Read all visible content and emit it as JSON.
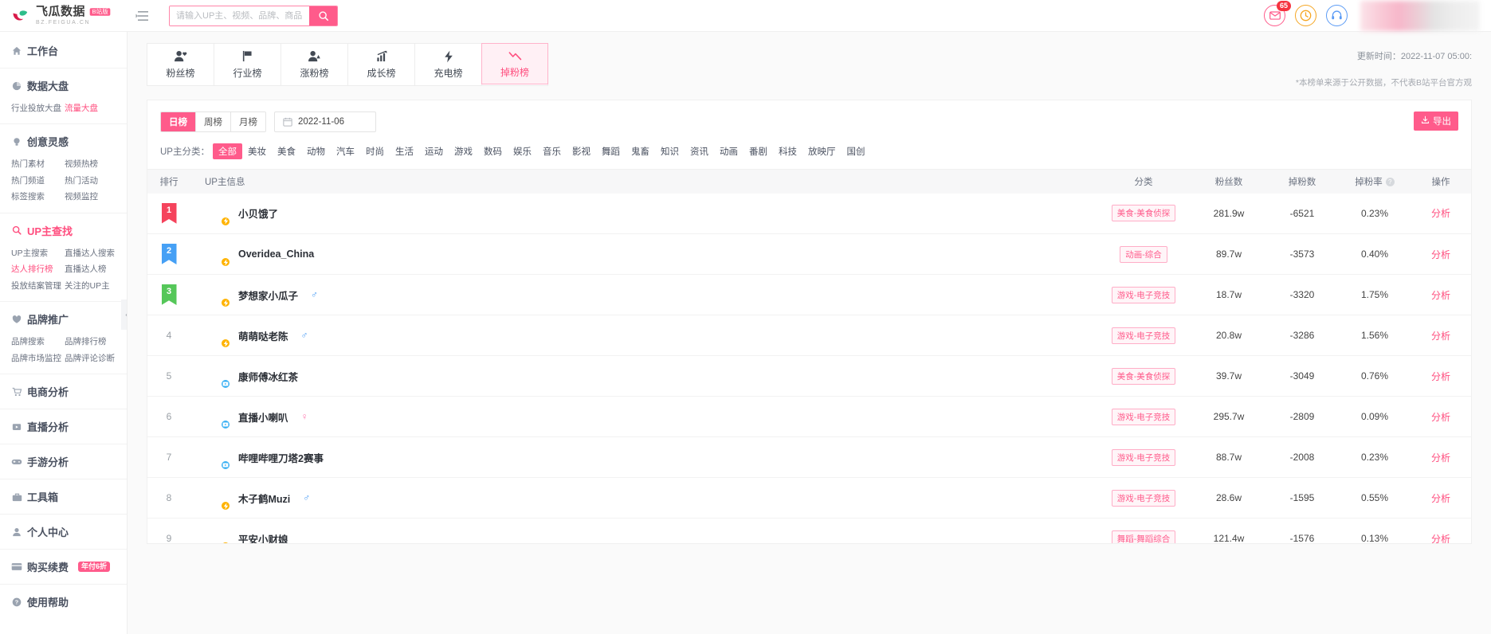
{
  "brand": {
    "name": "飞瓜数据",
    "badge": "B站版",
    "sub": "BZ.FEIGUA.CN"
  },
  "search": {
    "placeholder": "请输入UP主、视频、品牌、商品关键词搜索",
    "value": "",
    "icon": "search-icon"
  },
  "topbar": {
    "collapse_icon": "menu-collapse-icon",
    "mail_icon": "mail-icon",
    "mail_badge": "65",
    "clock_icon": "clock-icon",
    "service_icon": "headset-icon"
  },
  "sidebar": {
    "groups": [
      {
        "icon": "home-icon",
        "title": "工作台",
        "accent": false,
        "links": []
      },
      {
        "icon": "pie-chart-icon",
        "title": "数据大盘",
        "accent": false,
        "links": [
          {
            "label": "行业投放大盘",
            "active": false
          },
          {
            "label": "流量大盘",
            "active": true
          }
        ]
      },
      {
        "icon": "bulb-icon",
        "title": "创意灵感",
        "accent": false,
        "links": [
          {
            "label": "热门素材",
            "active": false
          },
          {
            "label": "视频热榜",
            "active": false
          },
          {
            "label": "热门频道",
            "active": false
          },
          {
            "label": "热门活动",
            "active": false
          },
          {
            "label": "标签搜索",
            "active": false
          },
          {
            "label": "视频监控",
            "active": false
          }
        ]
      },
      {
        "icon": "search-icon",
        "title": "UP主查找",
        "accent": true,
        "links": [
          {
            "label": "UP主搜索",
            "active": false
          },
          {
            "label": "直播达人搜索",
            "active": false
          },
          {
            "label": "达人排行榜",
            "active": true
          },
          {
            "label": "直播达人榜",
            "active": false
          },
          {
            "label": "投放结案管理",
            "active": false
          },
          {
            "label": "关注的UP主",
            "active": false
          }
        ]
      },
      {
        "icon": "heart-shield-icon",
        "title": "品牌推广",
        "accent": false,
        "links": [
          {
            "label": "品牌搜索",
            "active": false
          },
          {
            "label": "品牌排行榜",
            "active": false
          },
          {
            "label": "品牌市场监控",
            "active": false
          },
          {
            "label": "品牌评论诊断",
            "active": false
          }
        ]
      },
      {
        "icon": "cart-icon",
        "title": "电商分析",
        "accent": false,
        "links": []
      },
      {
        "icon": "live-icon",
        "title": "直播分析",
        "accent": false,
        "links": []
      },
      {
        "icon": "gamepad-icon",
        "title": "手游分析",
        "accent": false,
        "links": []
      },
      {
        "icon": "toolbox-icon",
        "title": "工具箱",
        "accent": false,
        "links": []
      },
      {
        "icon": "user-icon",
        "title": "个人中心",
        "accent": false,
        "links": []
      },
      {
        "icon": "card-icon",
        "title": "购买续费",
        "tag": "年付6折",
        "accent": false,
        "links": []
      },
      {
        "icon": "question-icon",
        "title": "使用帮助",
        "accent": false,
        "links": []
      }
    ],
    "collapse_handle": "«"
  },
  "tabs": [
    {
      "label": "粉丝榜",
      "icon": "fans-icon",
      "active": false
    },
    {
      "label": "行业榜",
      "icon": "flag-icon",
      "active": false
    },
    {
      "label": "涨粉榜",
      "icon": "fans-up-icon",
      "active": false
    },
    {
      "label": "成长榜",
      "icon": "growth-chart-icon",
      "active": false
    },
    {
      "label": "充电榜",
      "icon": "bolt-icon",
      "active": false
    },
    {
      "label": "掉粉榜",
      "icon": "chart-down-icon",
      "active": true
    }
  ],
  "header_meta": {
    "update_time": "更新时间：2022-11-07 05:00:",
    "note": "*本榜单来源于公开数据，不代表B站平台官方观"
  },
  "filters": {
    "period": [
      {
        "label": "日榜",
        "active": true
      },
      {
        "label": "周榜",
        "active": false
      },
      {
        "label": "月榜",
        "active": false
      }
    ],
    "date_icon": "calendar-icon",
    "date_value": "2022-11-06",
    "export_label": "导出",
    "export_icon": "export-icon",
    "category_label": "UP主分类：",
    "categories": [
      {
        "label": "全部",
        "active": true
      },
      {
        "label": "美妆",
        "active": false
      },
      {
        "label": "美食",
        "active": false
      },
      {
        "label": "动物",
        "active": false
      },
      {
        "label": "汽车",
        "active": false
      },
      {
        "label": "时尚",
        "active": false
      },
      {
        "label": "生活",
        "active": false
      },
      {
        "label": "运动",
        "active": false
      },
      {
        "label": "游戏",
        "active": false
      },
      {
        "label": "数码",
        "active": false
      },
      {
        "label": "娱乐",
        "active": false
      },
      {
        "label": "音乐",
        "active": false
      },
      {
        "label": "影视",
        "active": false
      },
      {
        "label": "舞蹈",
        "active": false
      },
      {
        "label": "鬼畜",
        "active": false
      },
      {
        "label": "知识",
        "active": false
      },
      {
        "label": "资讯",
        "active": false
      },
      {
        "label": "动画",
        "active": false
      },
      {
        "label": "番剧",
        "active": false
      },
      {
        "label": "科技",
        "active": false
      },
      {
        "label": "放映厅",
        "active": false
      },
      {
        "label": "国创",
        "active": false
      }
    ]
  },
  "table": {
    "columns": {
      "rank": "排行",
      "info": "UP主信息",
      "category": "分类",
      "fans": "粉丝数",
      "drop": "掉粉数",
      "rate": "掉粉率",
      "rate_help_icon": "question-icon",
      "action": "操作"
    },
    "rows": [
      {
        "rank": "1",
        "rank_style": "medal-red",
        "name": "小贝饿了",
        "gender": "",
        "avatar_colors": [
          "#f7d6b8",
          "#e8a87c"
        ],
        "badge": "bolt-icon",
        "badge_color": "#ffb300",
        "category": "美食-美食侦探",
        "fans": "281.9w",
        "drop": "-6521",
        "rate": "0.23%",
        "action": "分析"
      },
      {
        "rank": "2",
        "rank_style": "medal-blue",
        "name": "Overidea_China",
        "gender": "",
        "avatar_colors": [
          "#f5c518",
          "#8a7f6d"
        ],
        "badge": "bolt-icon",
        "badge_color": "#ffb300",
        "category": "动画-综合",
        "fans": "89.7w",
        "drop": "-3573",
        "rate": "0.40%",
        "action": "分析"
      },
      {
        "rank": "3",
        "rank_style": "medal-green",
        "name": "梦想家小瓜子",
        "gender": "male",
        "avatar_colors": [
          "#cdeef2",
          "#f6c6cf"
        ],
        "badge": "bolt-icon",
        "badge_color": "#ffb300",
        "category": "游戏-电子竞技",
        "fans": "18.7w",
        "drop": "-3320",
        "rate": "1.75%",
        "action": "分析"
      },
      {
        "rank": "4",
        "rank_style": "plain",
        "name": "萌萌哒老陈",
        "gender": "male",
        "avatar_colors": [
          "#2b2b2b",
          "#4a4a4a"
        ],
        "badge": "bolt-icon",
        "badge_color": "#ffb300",
        "category": "游戏-电子竞技",
        "fans": "20.8w",
        "drop": "-3286",
        "rate": "1.56%",
        "action": "分析"
      },
      {
        "rank": "5",
        "rank_style": "plain",
        "name": "康师傅冰红茶",
        "gender": "",
        "avatar_colors": [
          "#f7b733",
          "#d98f1e"
        ],
        "badge": "live-icon",
        "badge_color": "#3ab0f3",
        "category": "美食-美食侦探",
        "fans": "39.7w",
        "drop": "-3049",
        "rate": "0.76%",
        "action": "分析"
      },
      {
        "rank": "6",
        "rank_style": "plain",
        "name": "直播小喇叭",
        "gender": "female",
        "avatar_colors": [
          "#c9d6e2",
          "#8fa6bd"
        ],
        "badge": "live-icon",
        "badge_color": "#3ab0f3",
        "category": "游戏-电子竞技",
        "fans": "295.7w",
        "drop": "-2809",
        "rate": "0.09%",
        "action": "分析"
      },
      {
        "rank": "7",
        "rank_style": "plain",
        "name": "哔哩哔哩刀塔2赛事",
        "gender": "",
        "avatar_colors": [
          "#e03a3a",
          "#b52020"
        ],
        "badge": "live-icon",
        "badge_color": "#3ab0f3",
        "category": "游戏-电子竞技",
        "fans": "88.7w",
        "drop": "-2008",
        "rate": "0.23%",
        "action": "分析"
      },
      {
        "rank": "8",
        "rank_style": "plain",
        "name": "木子鹤Muzi",
        "gender": "male",
        "avatar_colors": [
          "#f3c9c9",
          "#d98b8b"
        ],
        "badge": "bolt-icon",
        "badge_color": "#ffb300",
        "category": "游戏-电子竞技",
        "fans": "28.6w",
        "drop": "-1595",
        "rate": "0.55%",
        "action": "分析"
      },
      {
        "rank": "9",
        "rank_style": "plain",
        "name": "平安小财娘",
        "gender": "",
        "avatar_colors": [
          "#e9bfa8",
          "#c98c6b"
        ],
        "badge": "bolt-icon",
        "badge_color": "#ffb300",
        "category": "舞蹈-舞蹈综合",
        "fans": "121.4w",
        "drop": "-1576",
        "rate": "0.13%",
        "action": "分析"
      }
    ]
  }
}
